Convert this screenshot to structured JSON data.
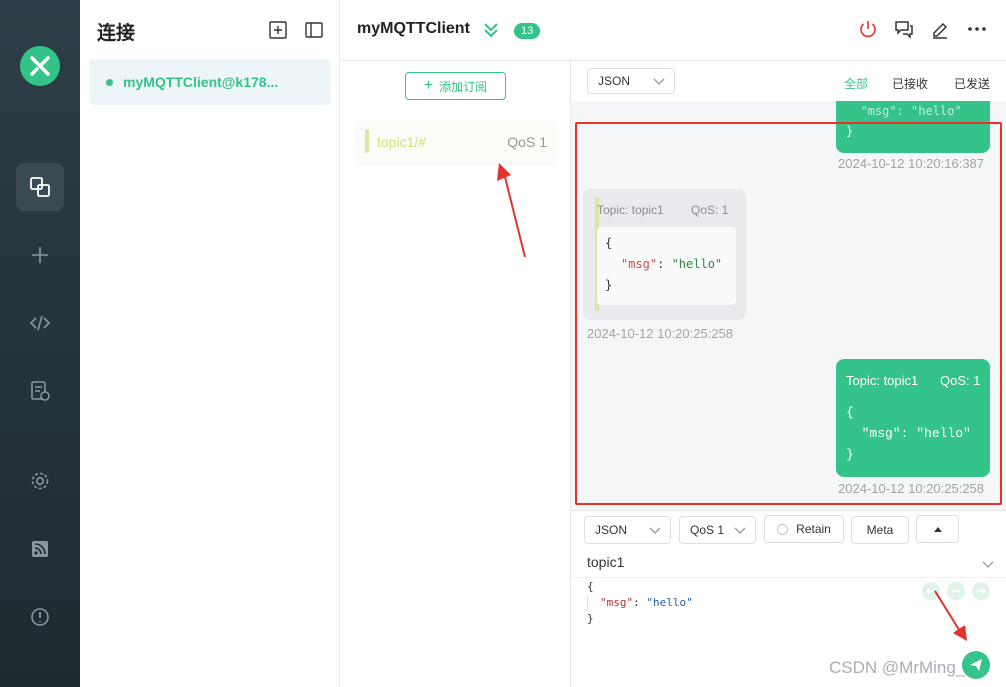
{
  "connections": {
    "title": "连接",
    "items": [
      {
        "name": "myMQTTClient@k178...",
        "status": "connected"
      }
    ]
  },
  "header": {
    "title": "myMQTTClient",
    "badge": "13",
    "icons": [
      "power-icon",
      "chat-icon",
      "edit-icon",
      "more-icon"
    ]
  },
  "subscriptions": {
    "add_label": "添加订阅",
    "items": [
      {
        "topic": "topic1/#",
        "qos": "QoS 1"
      }
    ]
  },
  "messages_toolbar": {
    "format": "JSON",
    "filters": [
      "全部",
      "已接收",
      "已发送"
    ],
    "active_filter": "全部"
  },
  "messages": {
    "partial": {
      "line": "  \"msg\": \"hello\"",
      "close": "}",
      "time": "2024-10-12 10:20:16:387"
    },
    "received": {
      "topic": "Topic: topic1",
      "qos": "QoS: 1",
      "payload_open": "{",
      "key": "\"msg\"",
      "sep": ": ",
      "value": "\"hello\"",
      "payload_close": "}",
      "time": "2024-10-12 10:20:25:258"
    },
    "sent": {
      "topic": "Topic: topic1",
      "qos": "QoS: 1",
      "payload": "{\n  \"msg\": \"hello\"\n}",
      "time": "2024-10-12 10:20:25:258"
    }
  },
  "composer": {
    "format": "JSON",
    "qos": "QoS 1",
    "retain_label": "Retain",
    "meta_label": "Meta",
    "topic": "topic1",
    "payload_open": "{",
    "key": "\"msg\"",
    "sep": ": ",
    "value": "\"hello\"",
    "payload_close": "}"
  },
  "watermark": "CSDN @MrMing_",
  "colors": {
    "accent": "#34c388",
    "nav_bg": "#2c3e47",
    "annotation": "#e5322d"
  }
}
